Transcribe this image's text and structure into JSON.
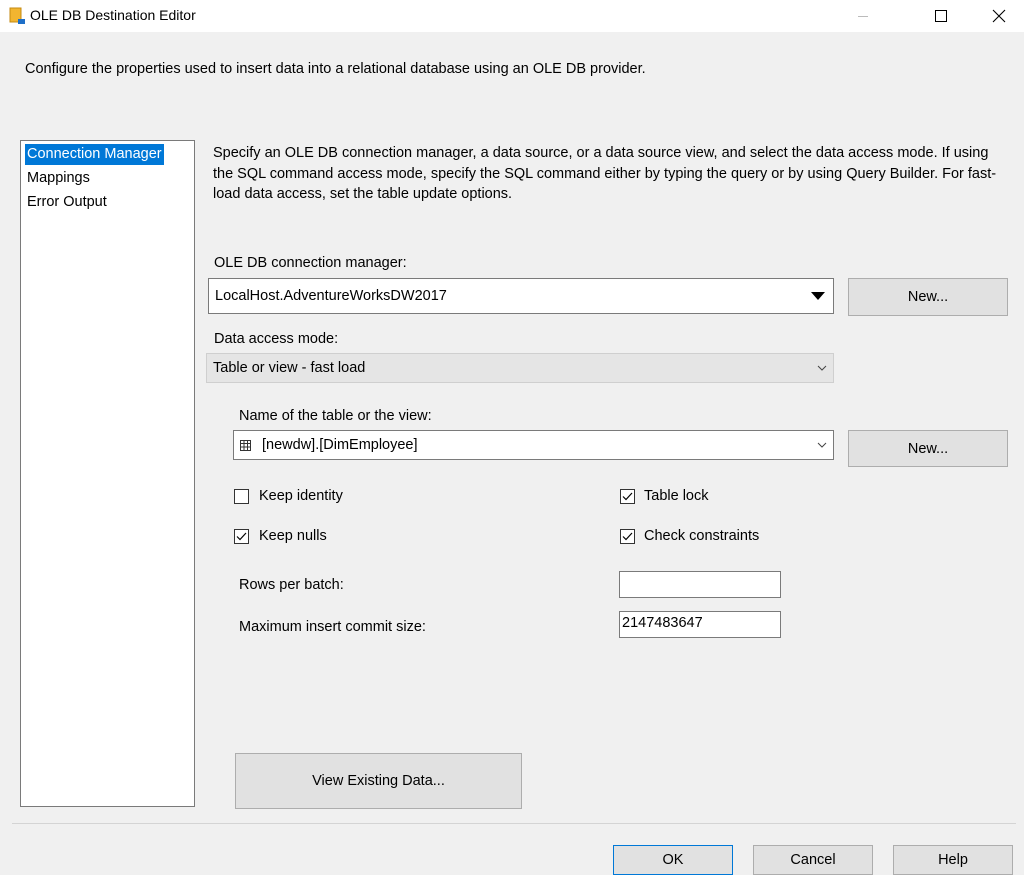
{
  "window": {
    "title": "OLE DB Destination Editor",
    "icon": "ssis-destination-icon"
  },
  "description": "Configure the properties used to insert data into a relational database using an OLE DB provider.",
  "nav": {
    "items": [
      {
        "label": "Connection Manager",
        "selected": true
      },
      {
        "label": "Mappings",
        "selected": false
      },
      {
        "label": "Error Output",
        "selected": false
      }
    ]
  },
  "instructions": "Specify an OLE DB connection manager, a data source, or a data source view, and select the data access mode. If using the SQL command access mode, specify the SQL command either by typing the query or by using Query Builder. For fast-load data access, set the table update options.",
  "connection_manager": {
    "label": "OLE DB connection manager:",
    "value": "LocalHost.AdventureWorksDW2017",
    "new_label": "New..."
  },
  "access_mode": {
    "label": "Data access mode:",
    "value": "Table or view - fast load"
  },
  "table": {
    "label": "Name of the table or the view:",
    "value": "[newdw].[DimEmployee]",
    "new_label": "New..."
  },
  "options": {
    "keep_identity": {
      "label": "Keep identity",
      "checked": false
    },
    "keep_nulls": {
      "label": "Keep nulls",
      "checked": true
    },
    "table_lock": {
      "label": "Table lock",
      "checked": true
    },
    "check_constraints": {
      "label": "Check constraints",
      "checked": true
    }
  },
  "rows_per_batch": {
    "label": "Rows per batch:",
    "value": ""
  },
  "max_commit": {
    "label": "Maximum insert commit size:",
    "value": "2147483647"
  },
  "view_data_label": "View Existing Data...",
  "footer": {
    "ok": "OK",
    "cancel": "Cancel",
    "help": "Help"
  }
}
